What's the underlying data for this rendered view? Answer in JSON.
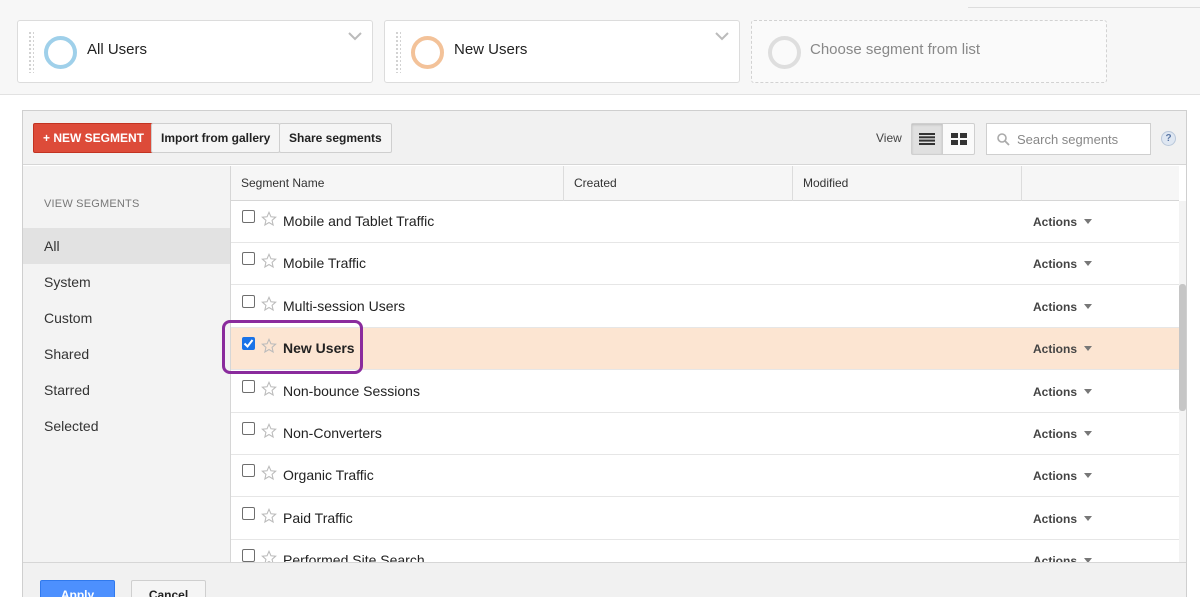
{
  "segment_bar": {
    "cards": [
      {
        "label": "All Users",
        "color": "#9fd0ea"
      },
      {
        "label": "New Users",
        "color": "#f3c299"
      }
    ],
    "placeholder": "Choose segment from list"
  },
  "toolbar": {
    "new_segment": "+ NEW SEGMENT",
    "import_gallery": "Import from gallery",
    "share_segments": "Share segments",
    "view_label": "View",
    "search_placeholder": "Search segments",
    "help": "?"
  },
  "sidebar": {
    "heading": "VIEW SEGMENTS",
    "items": [
      "All",
      "System",
      "Custom",
      "Shared",
      "Starred",
      "Selected"
    ],
    "active": "All"
  },
  "table": {
    "columns": [
      "Segment Name",
      "Created",
      "Modified"
    ],
    "rows": [
      {
        "name": "Mobile and Tablet Traffic",
        "checked": false,
        "actions": "Actions"
      },
      {
        "name": "Mobile Traffic",
        "checked": false,
        "actions": "Actions"
      },
      {
        "name": "Multi-session Users",
        "checked": false,
        "actions": "Actions"
      },
      {
        "name": "New Users",
        "checked": true,
        "actions": "Actions"
      },
      {
        "name": "Non-bounce Sessions",
        "checked": false,
        "actions": "Actions"
      },
      {
        "name": "Non-Converters",
        "checked": false,
        "actions": "Actions"
      },
      {
        "name": "Organic Traffic",
        "checked": false,
        "actions": "Actions"
      },
      {
        "name": "Paid Traffic",
        "checked": false,
        "actions": "Actions"
      },
      {
        "name": "Performed Site Search",
        "checked": false,
        "actions": "Actions"
      }
    ]
  },
  "footer": {
    "apply": "Apply",
    "cancel": "Cancel"
  },
  "colors": {
    "new_segment_button": "#dd4b39",
    "selected_row": "#fce5d2",
    "apply_button": "#4d90fe",
    "highlight_outline": "#8a2b9d"
  }
}
